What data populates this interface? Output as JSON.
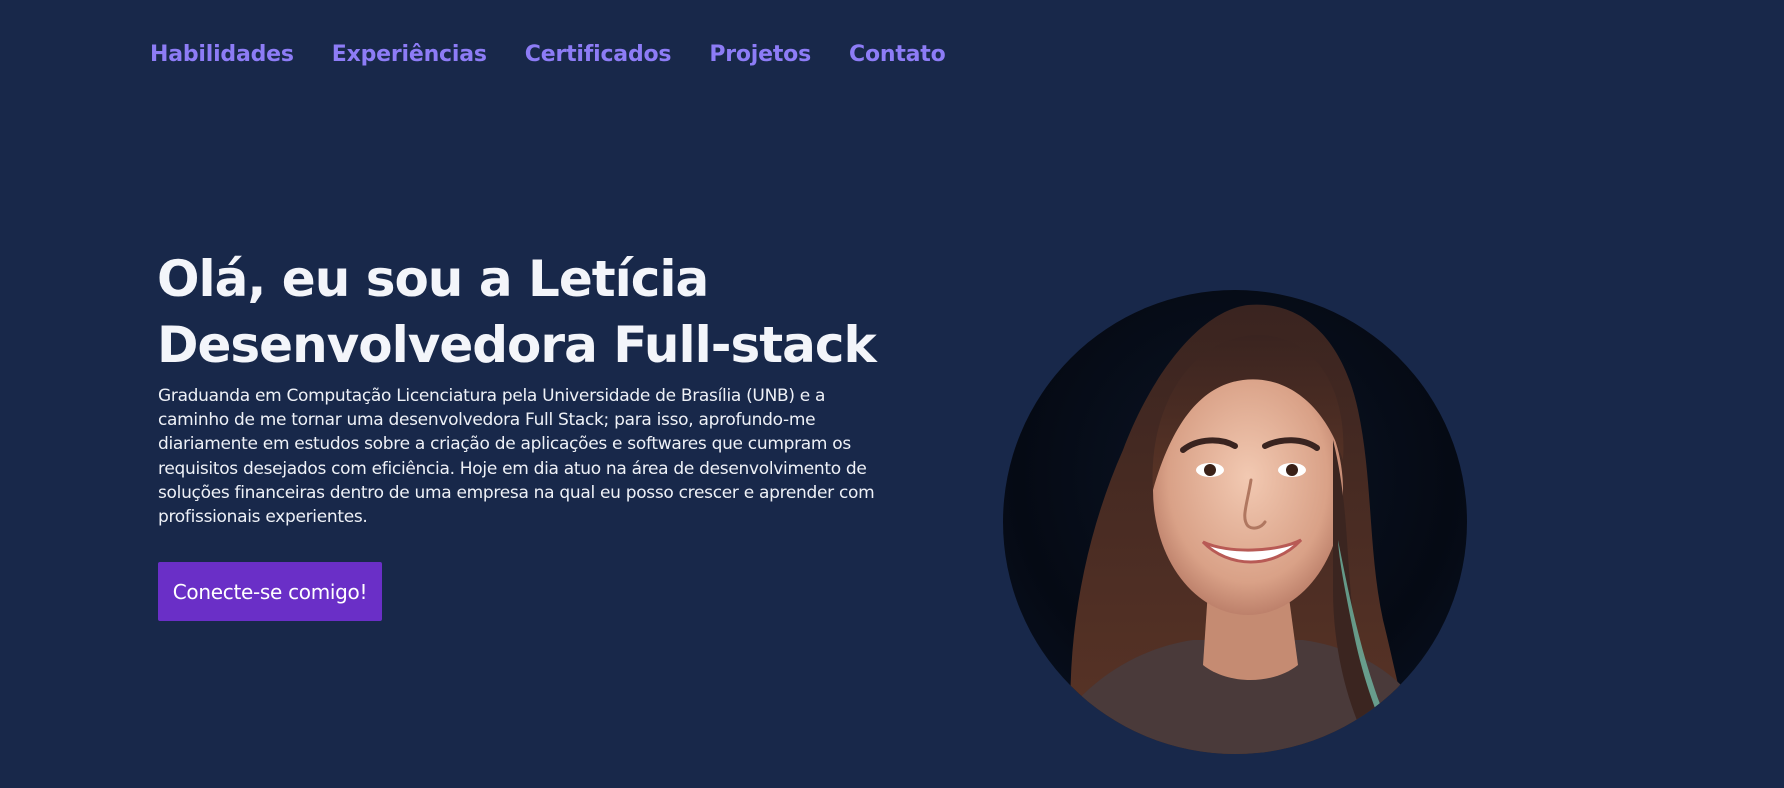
{
  "nav": {
    "items": [
      {
        "label": "Habilidades"
      },
      {
        "label": "Experiências"
      },
      {
        "label": "Certificados"
      },
      {
        "label": "Projetos"
      },
      {
        "label": "Contato"
      }
    ]
  },
  "hero": {
    "title_line1": "Olá, eu sou a Letícia",
    "title_line2": "Desenvolvedora Full-stack",
    "description": "Graduanda em Computação Licenciatura pela Universidade de Brasília (UNB) e a caminho de me tornar uma desenvolvedora Full Stack; para isso, aprofundo-me diariamente em estudos sobre a criação de aplicações e softwares que cumpram os requisitos desejados com eficiência. Hoje em dia atuo na área de desenvolvimento de soluções financeiras dentro de uma empresa na qual eu posso crescer e aprender com profissionais experientes.",
    "cta_label": "Conecte-se comigo!"
  },
  "colors": {
    "background": "#18284a",
    "nav_link": "#8d7cf6",
    "cta_background": "#6a2fc7",
    "text": "#eef1f7"
  },
  "icons": {
    "profile_photo": "profile-photo"
  }
}
